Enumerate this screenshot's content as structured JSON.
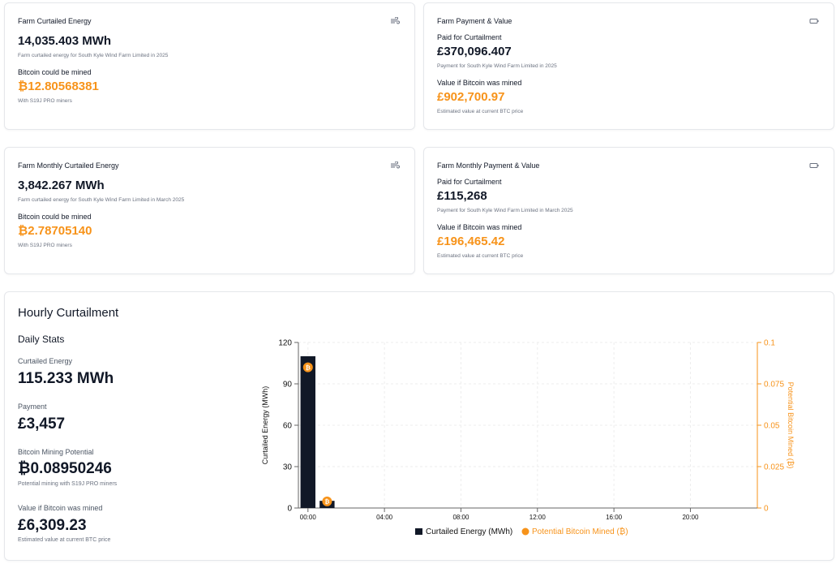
{
  "farm_curtailed": {
    "title": "Farm Curtailed Energy",
    "value": "14,035.403 MWh",
    "caption": "Farm curtailed energy for South Kyle Wind Farm Limited in 2025",
    "btc_label": "Bitcoin could be mined",
    "btc_value": "₿12.80568381",
    "btc_caption": "With S19J PRO miners"
  },
  "farm_payment": {
    "title": "Farm Payment & Value",
    "paid_label": "Paid for Curtailment",
    "paid_value": "£370,096.407",
    "paid_caption": "Payment for South Kyle Wind Farm Limited in 2025",
    "value_label": "Value if Bitcoin was mined",
    "value_value": "£902,700.97",
    "value_caption": "Estimated value at current BTC price"
  },
  "monthly_curtailed": {
    "title": "Farm Monthly Curtailed Energy",
    "value": "3,842.267 MWh",
    "caption": "Farm curtailed energy for South Kyle Wind Farm Limited in March 2025",
    "btc_label": "Bitcoin could be mined",
    "btc_value": "₿2.78705140",
    "btc_caption": "With S19J PRO miners"
  },
  "monthly_payment": {
    "title": "Farm Monthly Payment & Value",
    "paid_label": "Paid for Curtailment",
    "paid_value": "£115,268",
    "paid_caption": "Payment for South Kyle Wind Farm Limited in March 2025",
    "value_label": "Value if Bitcoin was mined",
    "value_value": "£196,465.42",
    "value_caption": "Estimated value at current BTC price"
  },
  "hourly": {
    "title": "Hourly Curtailment",
    "daily_stats_title": "Daily Stats",
    "energy_label": "Curtailed Energy",
    "energy_value": "115.233 MWh",
    "payment_label": "Payment",
    "payment_value": "£3,457",
    "mining_label": "Bitcoin Mining Potential",
    "mining_value": "₿0.08950246",
    "mining_caption": "Potential mining with S19J PRO miners",
    "btc_value_label": "Value if Bitcoin was mined",
    "btc_value_value": "£6,309.23",
    "btc_value_caption": "Estimated value at current BTC price"
  },
  "colors": {
    "accent": "#f7931a",
    "bar": "#111827"
  },
  "icons": {
    "energy_card": "wind-icon",
    "payment_card": "wallet-icon",
    "bitcoin_marker": "bitcoin-icon"
  },
  "chart_data": {
    "type": "bar",
    "x": [
      "00:00",
      "01:00",
      "02:00",
      "03:00",
      "04:00",
      "05:00",
      "06:00",
      "07:00",
      "08:00",
      "09:00",
      "10:00",
      "11:00",
      "12:00",
      "13:00",
      "14:00",
      "15:00",
      "16:00",
      "17:00",
      "18:00",
      "19:00",
      "20:00",
      "21:00",
      "22:00",
      "23:00"
    ],
    "x_tick_labels": [
      "00:00",
      "04:00",
      "08:00",
      "12:00",
      "16:00",
      "20:00"
    ],
    "series": [
      {
        "name": "Curtailed Energy (MWh)",
        "type": "bar",
        "axis": "left",
        "values": [
          110,
          5.2,
          0,
          0,
          0,
          0,
          0,
          0,
          0,
          0,
          0,
          0,
          0,
          0,
          0,
          0,
          0,
          0,
          0,
          0,
          0,
          0,
          0,
          0
        ]
      },
      {
        "name": "Potential Bitcoin Mined (₿)",
        "type": "scatter",
        "axis": "right",
        "values": [
          0.085,
          0.004,
          null,
          null,
          null,
          null,
          null,
          null,
          null,
          null,
          null,
          null,
          null,
          null,
          null,
          null,
          null,
          null,
          null,
          null,
          null,
          null,
          null,
          null
        ]
      }
    ],
    "ylabel": "Curtailed Energy (MWh)",
    "ylabel_right": "Potential Bitcoin Mined (₿)",
    "ylim": [
      0,
      120
    ],
    "ylim_right": [
      0,
      0.1
    ],
    "yticks": [
      "0",
      "30",
      "60",
      "90",
      "120"
    ],
    "yticks_right": [
      "0",
      "0.025",
      "0.05",
      "0.075",
      "0.1"
    ],
    "legend": "bottom",
    "grid": true
  }
}
